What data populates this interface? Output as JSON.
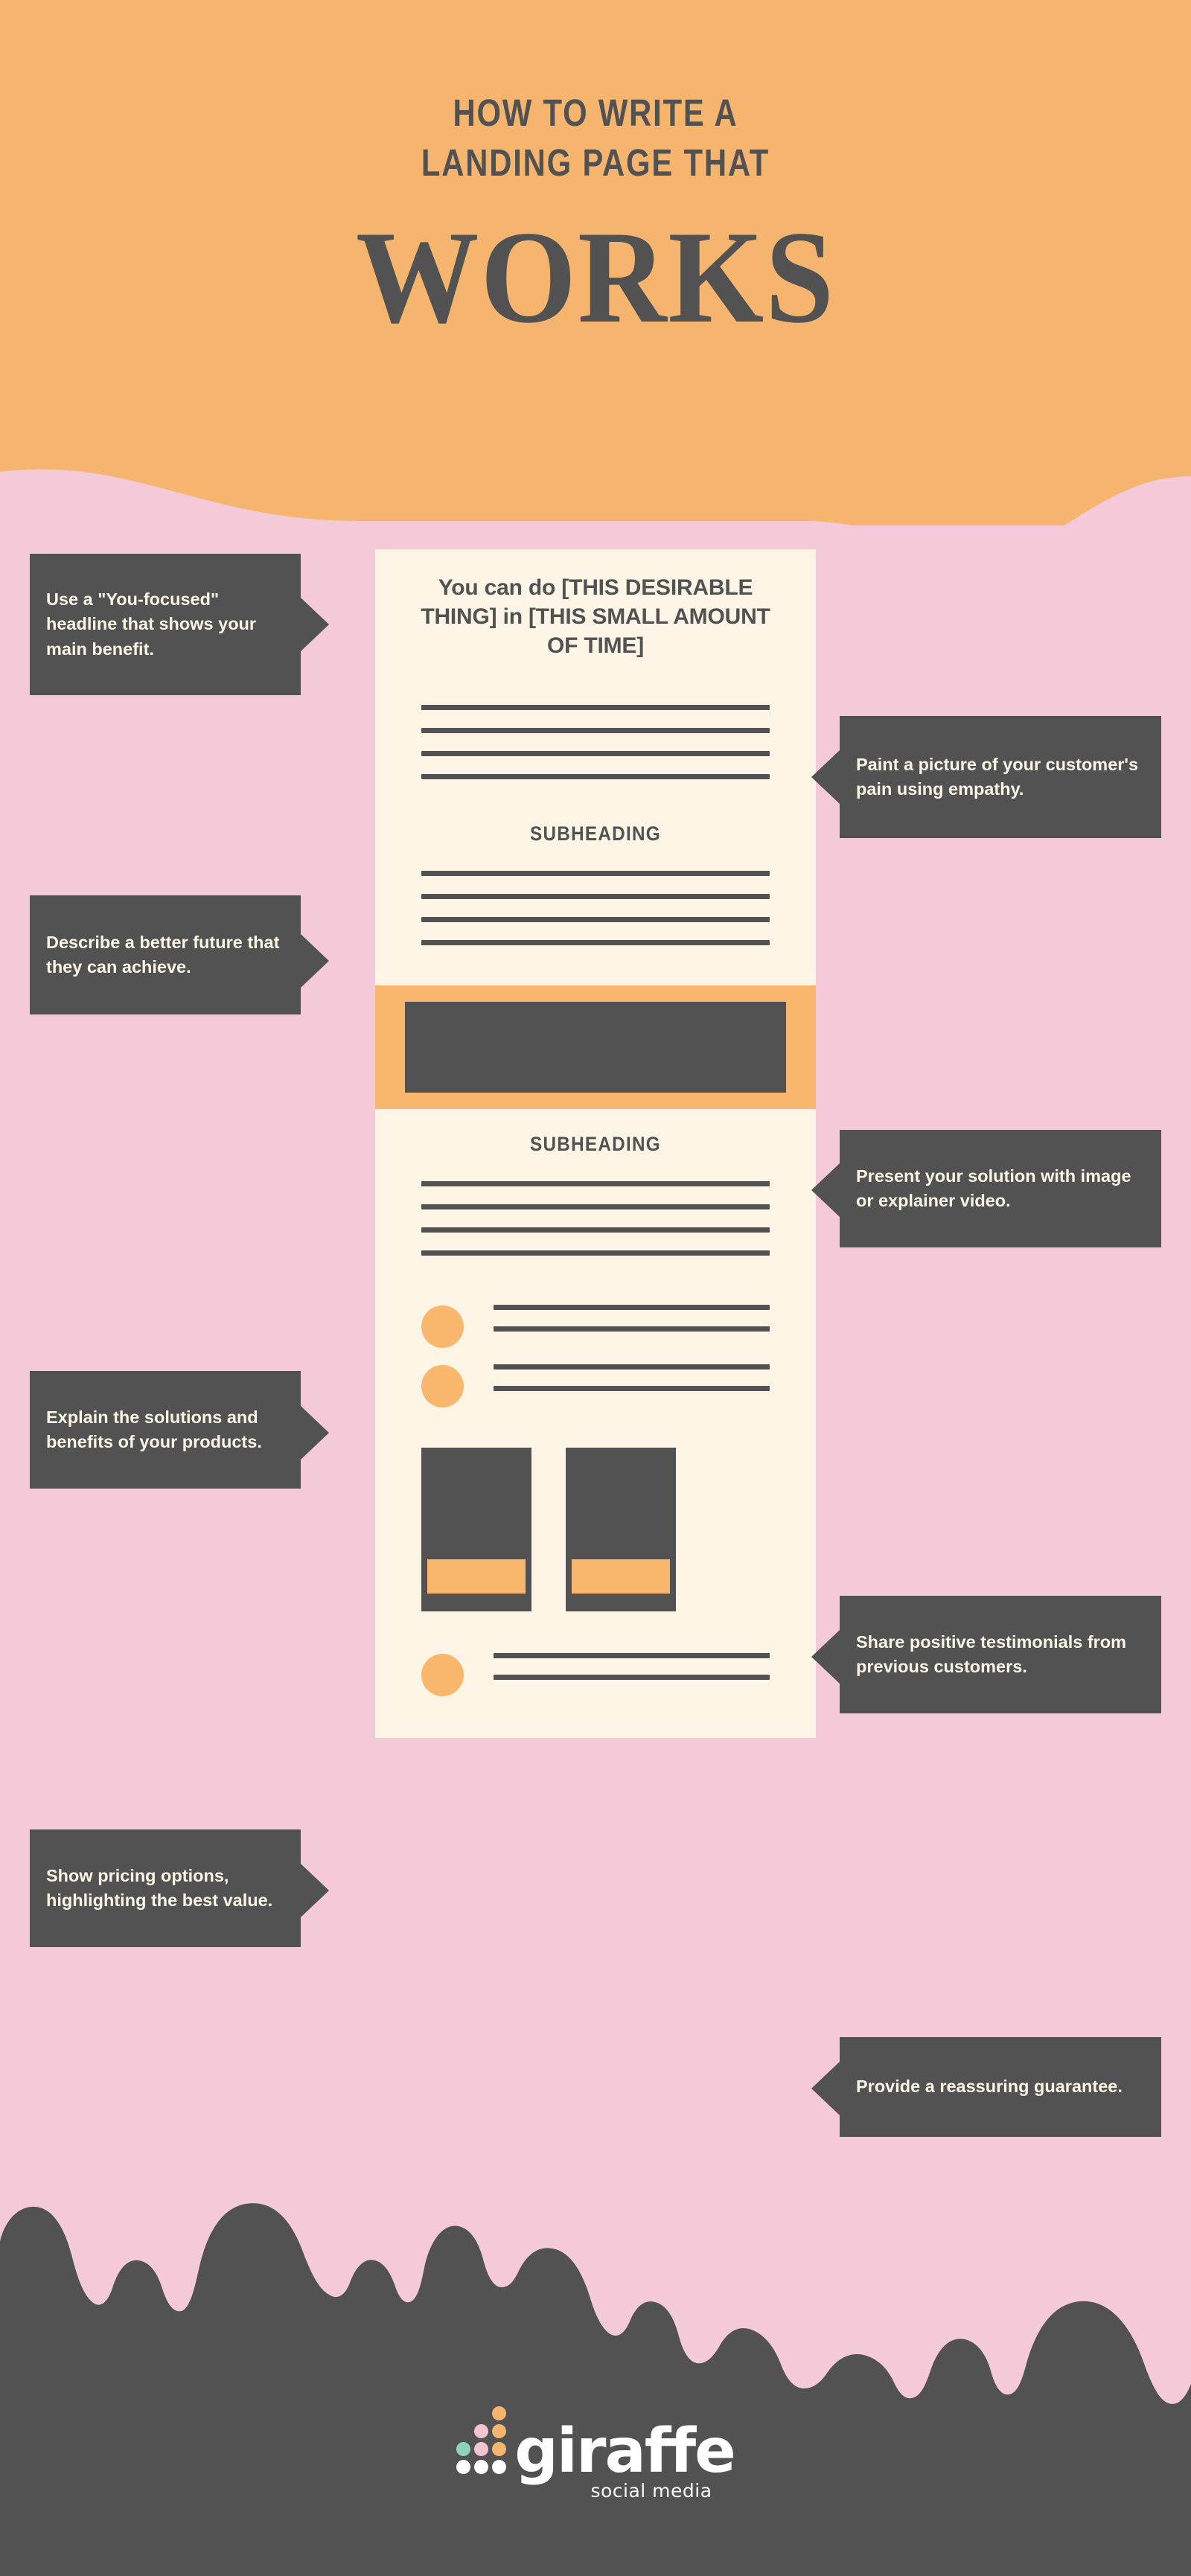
{
  "colors": {
    "orange": "#F5B56F",
    "orange_accent": "#F8B76D",
    "pink": "#F5CAD8",
    "cream": "#FCF5E6",
    "dark": "#525252",
    "teal": "#8DD3C0",
    "logo_pink": "#F2C4D2",
    "white": "#FFFFFF"
  },
  "header": {
    "line1": "HOW TO WRITE A",
    "line2": "LANDING PAGE THAT",
    "line3": "WORKS"
  },
  "mock": {
    "headline": "You can do [THIS DESIRABLE THING]  in [THIS SMALL AMOUNT OF TIME]",
    "subheading_1": "SUBHEADING",
    "subheading_2": "SUBHEADING",
    "text_block_1_lines": 4,
    "text_block_2_lines": 4,
    "text_block_3_lines": 4,
    "media_label": "image-or-video-placeholder",
    "testimonials": [
      {
        "avatar": "avatar-circle",
        "lines": 2
      },
      {
        "avatar": "avatar-circle",
        "lines": 2
      }
    ],
    "pricing_cards": [
      {
        "label": "pricing-card-1",
        "cta": "cta-bar"
      },
      {
        "label": "pricing-card-2",
        "cta": "cta-bar"
      }
    ],
    "guarantee": {
      "avatar": "avatar-circle",
      "lines": 2
    }
  },
  "callouts": [
    {
      "id": "headline-tip",
      "side": "left",
      "text": "Use a \"You-focused\" headline that shows your main benefit."
    },
    {
      "id": "pain-tip",
      "side": "right",
      "text": "Paint a picture of your customer's pain using empathy."
    },
    {
      "id": "future-tip",
      "side": "left",
      "text": "Describe a better future that they can achieve."
    },
    {
      "id": "solution-tip",
      "side": "right",
      "text": "Present your solution with image or explainer video."
    },
    {
      "id": "benefits-tip",
      "side": "left",
      "text": "Explain the solutions and benefits of your products."
    },
    {
      "id": "testimonials-tip",
      "side": "right",
      "text": "Share positive testimonials from previous customers."
    },
    {
      "id": "pricing-tip",
      "side": "left",
      "text": "Show pricing options, highlighting the best value."
    },
    {
      "id": "guarantee-tip",
      "side": "right",
      "text": "Provide a reassuring guarantee."
    }
  ],
  "footer": {
    "brand": "giraffe",
    "tagline": "social media",
    "logo_dots": [
      [
        "empty",
        "empty",
        "orange"
      ],
      [
        "empty",
        "logo_pink",
        "orange"
      ],
      [
        "teal",
        "logo_pink",
        "orange"
      ],
      [
        "white",
        "white",
        "white"
      ]
    ]
  }
}
